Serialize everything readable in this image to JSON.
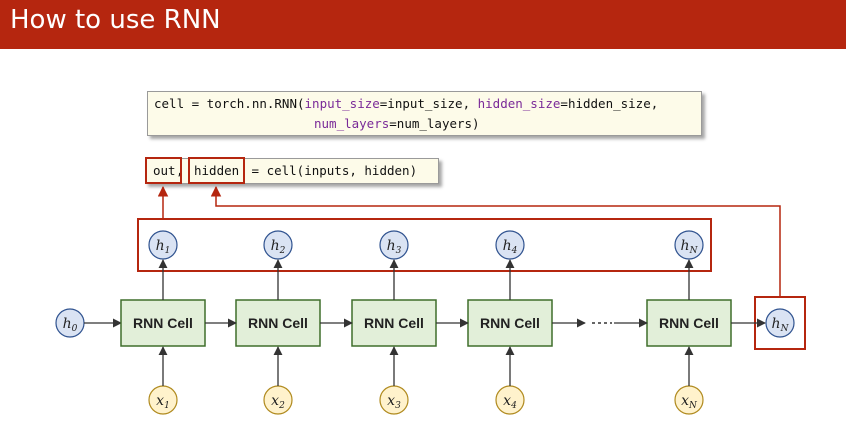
{
  "header": {
    "title": "How to use RNN",
    "background": "#b5260f"
  },
  "code": {
    "line1": {
      "prefix": "cell = torch.nn.RNN(",
      "input_kw": "input_size",
      "input_val": "=input_size, ",
      "hidden_kw": "hidden_size",
      "hidden_val": "=hidden_size,"
    },
    "line2": {
      "layers_kw": "num_layers",
      "layers_val": "=num_layers)"
    },
    "call": {
      "out": "out",
      "comma": ",",
      "hidden": "hidden",
      "rest": " = cell(inputs, hidden)"
    }
  },
  "diagram": {
    "cell_label": "RNN Cell",
    "initial_hidden": {
      "sym": "h",
      "sub": "0"
    },
    "final_hidden": {
      "sym": "h",
      "sub": "N"
    },
    "hidden_outputs": [
      {
        "sym": "h",
        "sub": "1"
      },
      {
        "sym": "h",
        "sub": "2"
      },
      {
        "sym": "h",
        "sub": "3"
      },
      {
        "sym": "h",
        "sub": "4"
      },
      {
        "sym": "h",
        "sub": "N"
      }
    ],
    "inputs": [
      {
        "sym": "x",
        "sub": "1"
      },
      {
        "sym": "x",
        "sub": "2"
      },
      {
        "sym": "x",
        "sub": "3"
      },
      {
        "sym": "x",
        "sub": "4"
      },
      {
        "sym": "x",
        "sub": "N"
      }
    ],
    "colors": {
      "cell_fill": "#e2efd9",
      "cell_stroke": "#3f6e2b",
      "hidden_fill": "#dae3f3",
      "hidden_stroke": "#2f528f",
      "input_fill": "#fff2cc",
      "input_stroke": "#b08a1e",
      "highlight": "#b5260f"
    }
  }
}
